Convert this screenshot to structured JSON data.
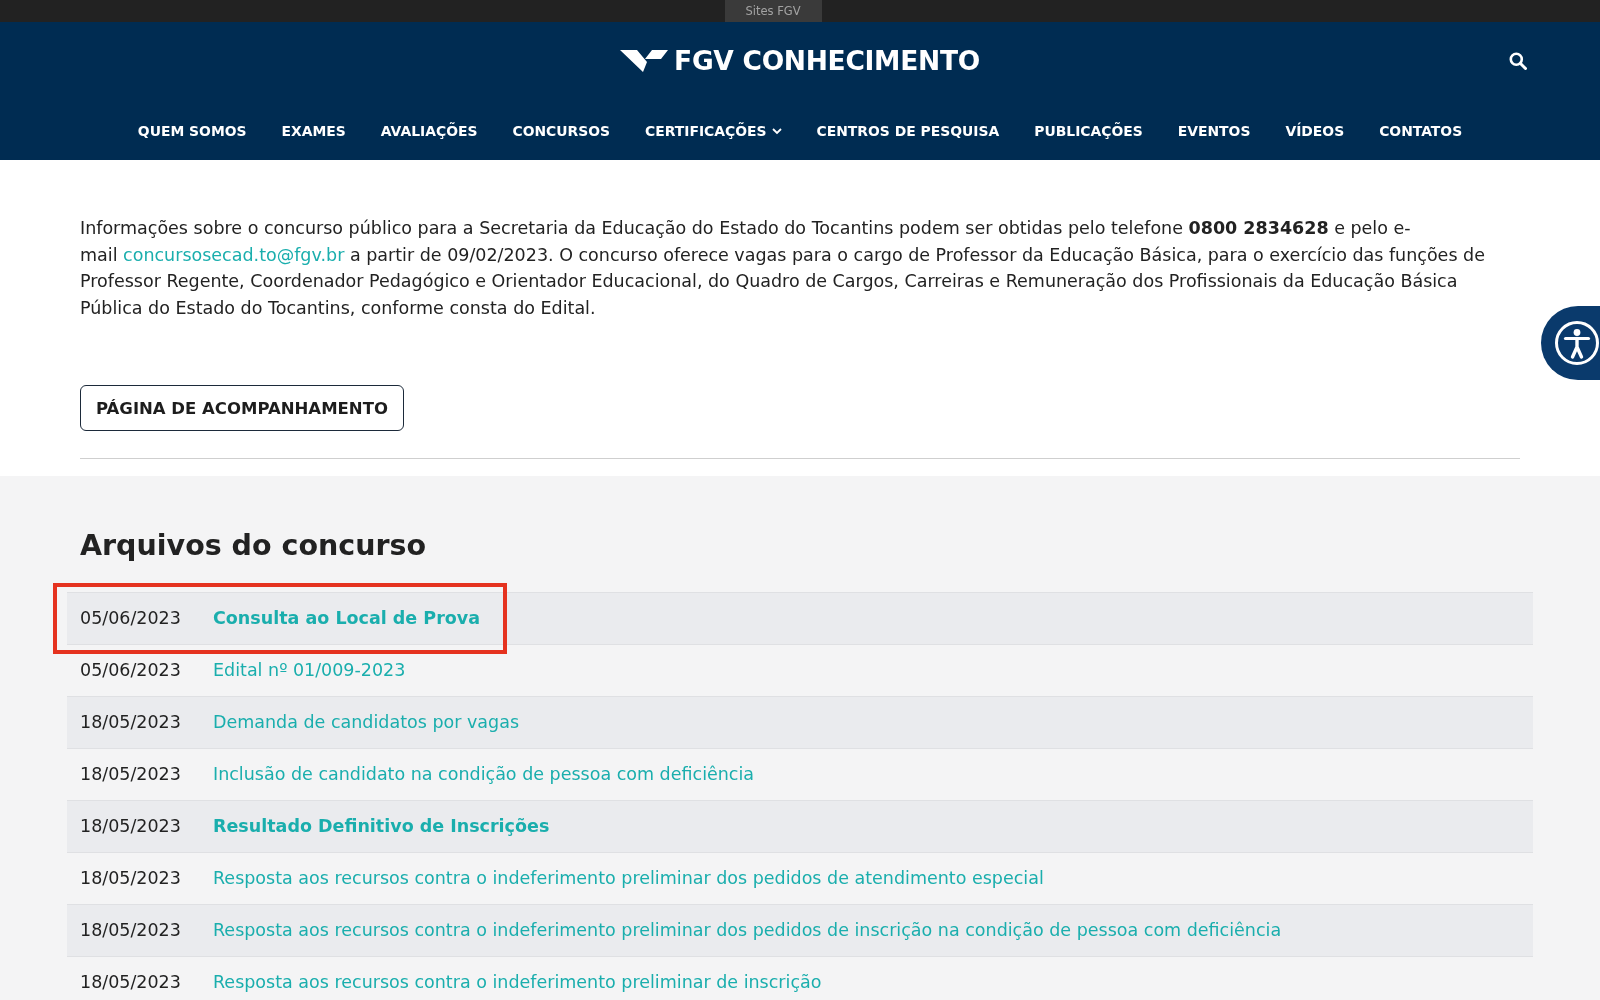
{
  "top_bar": {
    "sites_tab": "Sites FGV"
  },
  "header": {
    "logo": "FGV CONHECIMENTO",
    "nav": [
      {
        "label": "QUEM SOMOS",
        "dropdown": false
      },
      {
        "label": "EXAMES",
        "dropdown": false
      },
      {
        "label": "AVALIAÇÕES",
        "dropdown": false
      },
      {
        "label": "CONCURSOS",
        "dropdown": false
      },
      {
        "label": "CERTIFICAÇÕES",
        "dropdown": true
      },
      {
        "label": "CENTROS DE PESQUISA",
        "dropdown": false
      },
      {
        "label": "PUBLICAÇÕES",
        "dropdown": false
      },
      {
        "label": "EVENTOS",
        "dropdown": false
      },
      {
        "label": "VÍDEOS",
        "dropdown": false
      },
      {
        "label": "CONTATOS",
        "dropdown": false
      }
    ]
  },
  "intro": {
    "before": "Informações sobre o concurso público para a Secretaria da Educação do Estado do Tocantins podem ser obtidas pelo telefone **0800 2834628** e pelo e-mail",
    "email": "concursosecad.to@fgv.br",
    "after": "a partir de 09/02/2023. O concurso oferece vagas para o cargo de Professor da Educação Básica, para o exercício das funções de Professor Regente, Coordenador Pedagógico e Orientador Educacional, do Quadro de Cargos, Carreiras e Remuneração dos Profissionais da Educação Básica Pública do Estado do Tocantins, conforme consta do Edital."
  },
  "follow_button": "PÁGINA DE ACOMPANHAMENTO",
  "files": {
    "title": "Arquivos do concurso",
    "rows": [
      {
        "date": "05/06/2023",
        "title": "Consulta ao Local de Prova",
        "bold": true,
        "highlighted": true
      },
      {
        "date": "05/06/2023",
        "title": "Edital nº 01/009-2023",
        "bold": false,
        "highlighted": false
      },
      {
        "date": "18/05/2023",
        "title": "Demanda de candidatos por vagas",
        "bold": false,
        "highlighted": false
      },
      {
        "date": "18/05/2023",
        "title": "Inclusão de candidato na condição de pessoa com deficiência",
        "bold": false,
        "highlighted": false
      },
      {
        "date": "18/05/2023",
        "title": "Resultado Definitivo de Inscrições",
        "bold": true,
        "highlighted": false
      },
      {
        "date": "18/05/2023",
        "title": "Resposta aos recursos contra o indeferimento preliminar dos pedidos de atendimento especial",
        "bold": false,
        "highlighted": false
      },
      {
        "date": "18/05/2023",
        "title": "Resposta aos recursos contra o indeferimento preliminar dos pedidos de inscrição na condição de pessoa com deficiência",
        "bold": false,
        "highlighted": false
      },
      {
        "date": "18/05/2023",
        "title": "Resposta aos recursos contra o indeferimento preliminar de inscrição",
        "bold": false,
        "highlighted": false
      }
    ]
  }
}
